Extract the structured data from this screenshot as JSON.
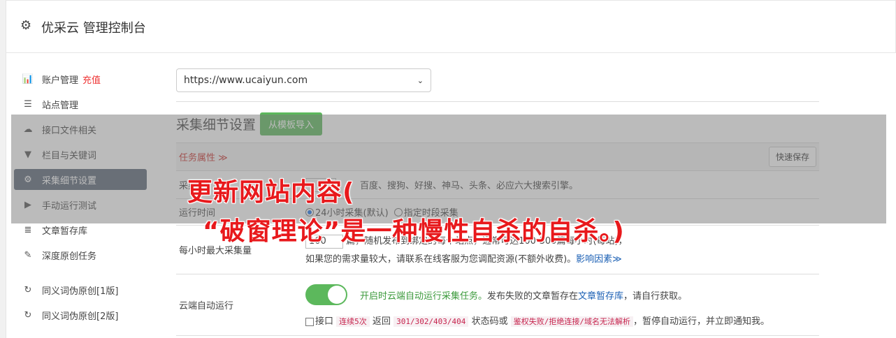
{
  "header": {
    "title": "优采云 管理控制台"
  },
  "sidebar": {
    "items": [
      {
        "label": "账户管理",
        "extra": "充值",
        "icon": "bar-chart-icon",
        "glyph": "📊"
      },
      {
        "label": "站点管理",
        "icon": "server-icon",
        "glyph": "☰"
      },
      {
        "label": "接口文件相关",
        "icon": "cloud-upload-icon",
        "glyph": "☁"
      },
      {
        "label": "栏目与关键词",
        "icon": "filter-icon",
        "glyph": "▼"
      },
      {
        "label": "采集细节设置",
        "icon": "gears-icon",
        "glyph": "⚙"
      },
      {
        "label": "手动运行测试",
        "icon": "play-circle-icon",
        "glyph": "▶"
      },
      {
        "label": "文章暂存库",
        "icon": "database-icon",
        "glyph": "≣"
      },
      {
        "label": "深度原创任务",
        "icon": "edit-icon",
        "glyph": "✎"
      },
      {
        "label": "同义词伪原创[1版]",
        "icon": "refresh-icon",
        "glyph": "↻"
      },
      {
        "label": "同义词伪原创[2版]",
        "icon": "refresh-icon",
        "glyph": "↻"
      }
    ]
  },
  "main": {
    "site_select": "https://www.ucaiyun.com",
    "section_title": "采集细节设置",
    "import_button": "从模板导入",
    "task_attr": "任务属性 ≫",
    "quick_save": "快速保存",
    "rows": {
      "r1_label": "采集",
      "r1_text": "百度、搜狗、好搜、神马、头条、必应六大搜索引擎。",
      "r2_label": "运行时间",
      "r2_opt1": "24小时采集(默认)",
      "r2_opt2": "指定时段采集",
      "r3_label": "每小时最大采集量",
      "r3_value": "100",
      "r3_line1": "篇，随机发布到绑定的每个站点，通常可达100-300篇每小时(每站)，",
      "r3_line2": "如果您的需求量较大，请联系在线客服为您调配资源(不额外收费)。",
      "r3_link": "影响因素≫",
      "r4_label": "云端自动运行",
      "r4_green": "开启时云端自动运行采集任务。",
      "r4_text1": "发布失败的文章暂存在",
      "r4_link": "文章暂存库",
      "r4_text2": "，请自行获取。",
      "r4_chk": "接口",
      "r4_code1": "连续5次",
      "r4_t3": "返回",
      "r4_code2": "301/302/403/404",
      "r4_t4": "状态码或",
      "r4_code3": "鉴权失败/拒绝连接/域名无法解析",
      "r4_t5": "，暂停自动运行，并立即通知我。"
    }
  },
  "overlay": {
    "caption_line1": "更新网站内容(",
    "caption_line2": "“破窗理论”是一种慢性自杀的自杀。)"
  }
}
